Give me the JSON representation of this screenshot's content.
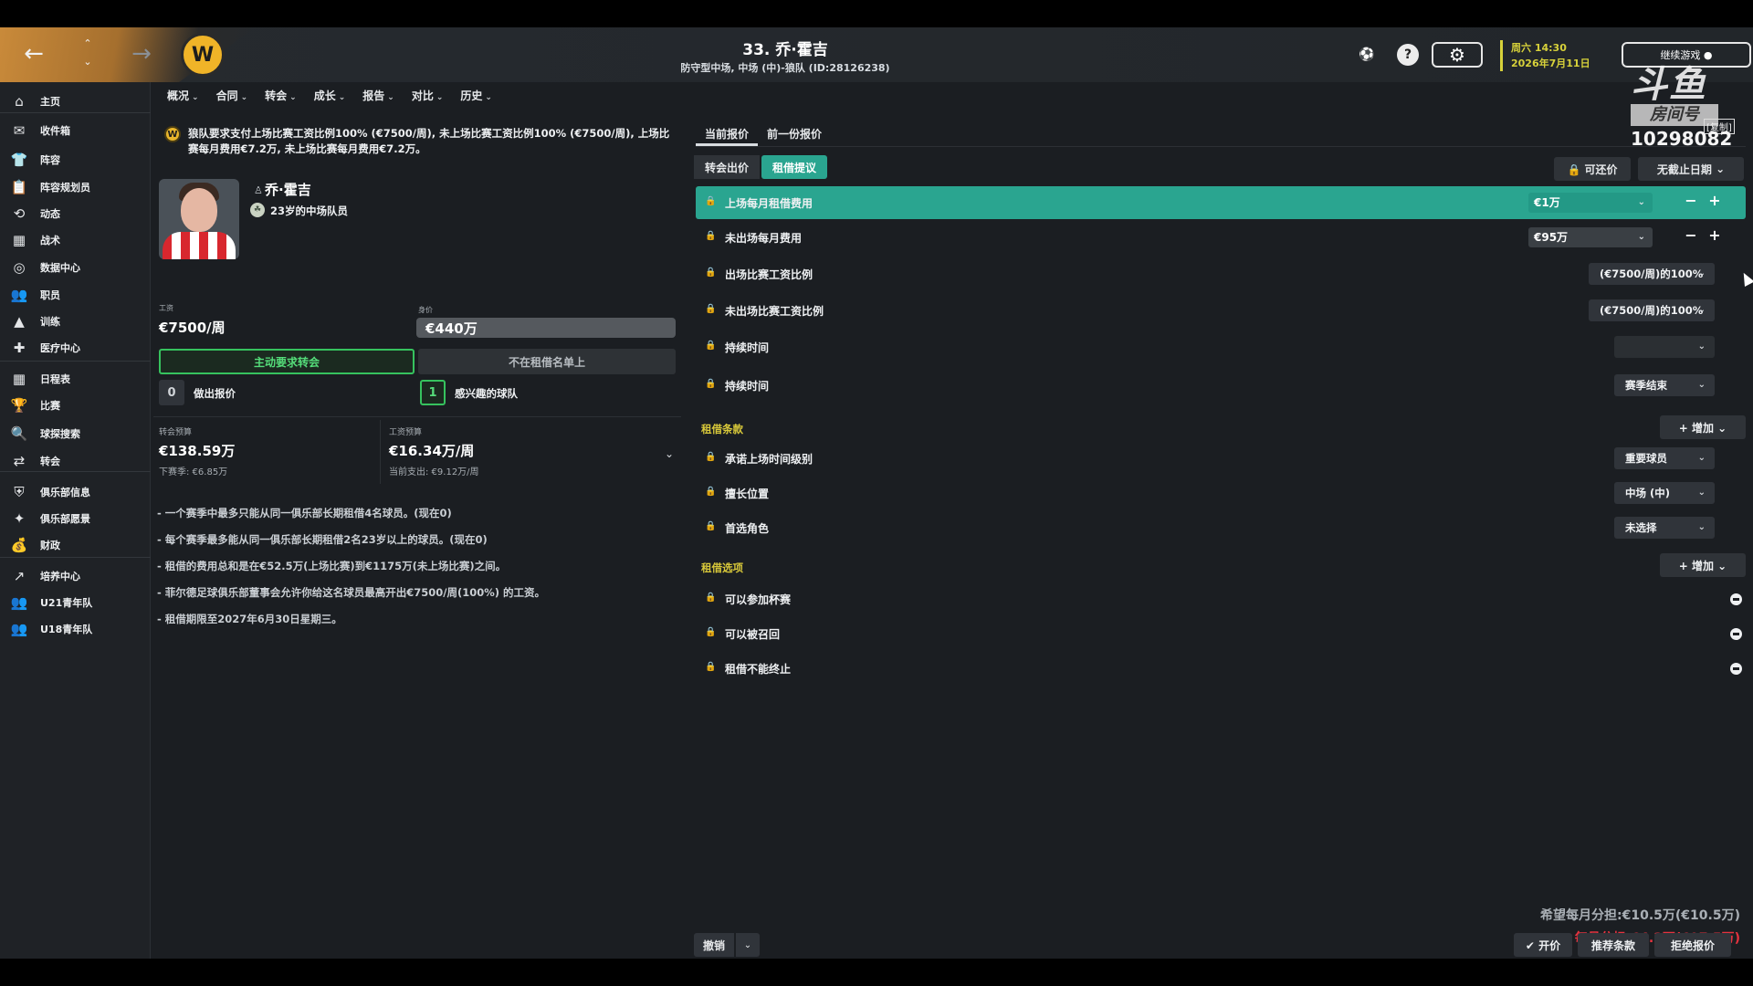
{
  "header": {
    "title": "33. 乔·霍吉",
    "subtitle": "防守型中场, 中场 (中)-狼队 (ID:28126238)",
    "back_icon": "←",
    "forward_icon": "→",
    "up_icon": "⌃",
    "down_icon": "⌄",
    "crest_icon": "W",
    "ball_icon": "⚽",
    "help_icon": "?",
    "settings_icon": "⚙",
    "date_line1": "周六 14:30",
    "date_line2": "2026年7月11日",
    "continue_label": "继续游戏 ●"
  },
  "watermark": {
    "logo": "斗鱼",
    "room_label": "房间号",
    "room_number": "10298082",
    "tag": "[复制]"
  },
  "sidebar": {
    "items": [
      {
        "label": "主页",
        "icon": "⌂"
      },
      {
        "label": "收件箱",
        "icon": "✉"
      },
      {
        "label": "阵容",
        "icon": "👕"
      },
      {
        "label": "阵容规划员",
        "icon": "📋"
      },
      {
        "label": "动态",
        "icon": "⟲"
      },
      {
        "label": "战术",
        "icon": "▦"
      },
      {
        "label": "数据中心",
        "icon": "◎"
      },
      {
        "label": "职员",
        "icon": "👥"
      },
      {
        "label": "训练",
        "icon": "▲"
      },
      {
        "label": "医疗中心",
        "icon": "✚"
      },
      {
        "label": "日程表",
        "icon": "▦"
      },
      {
        "label": "比赛",
        "icon": "🏆"
      },
      {
        "label": "球探搜索",
        "icon": "🔍"
      },
      {
        "label": "转会",
        "icon": "⇄"
      },
      {
        "label": "俱乐部信息",
        "icon": "⛨"
      },
      {
        "label": "俱乐部愿景",
        "icon": "✦"
      },
      {
        "label": "财政",
        "icon": "💰"
      },
      {
        "label": "培养中心",
        "icon": "↗"
      },
      {
        "label": "U21青年队",
        "icon": "👥"
      },
      {
        "label": "U18青年队",
        "icon": "👥"
      }
    ]
  },
  "menu": {
    "items": [
      "概况",
      "合同",
      "转会",
      "成长",
      "报告",
      "对比",
      "历史"
    ],
    "chevron": "⌄"
  },
  "left": {
    "notice_icon": "W",
    "notice": "狼队要求支付上场比赛工资比例100% (€7500/周), 未上场比赛工资比例100% (€7500/周), 上场比赛每月费用€7.2万, 未上场比赛每月费用€7.2万。",
    "player_name": "乔·霍吉",
    "player_name_icon": "♙",
    "player_desc": "23岁的中场队员",
    "player_desc_icon": "☘",
    "wage_label": "工资",
    "wage_value": "€7500/周",
    "value_label": "身价",
    "value_value": "€440万",
    "btn_transfer": "主动要求转会",
    "btn_not_loan": "不在租借名单上",
    "offers_count": "0",
    "offers_label": "做出报价",
    "interest_count": "1",
    "interest_label": "感兴趣的球队",
    "transfer_budget_label": "转会预算",
    "transfer_budget_value": "€138.59万",
    "transfer_budget_sub": "下赛季: €6.85万",
    "wage_budget_label": "工资预算",
    "wage_budget_value": "€16.34万/周",
    "wage_budget_sub": "当前支出: €9.12万/周",
    "rules": [
      "- 一个赛季中最多只能从同一俱乐部长期租借4名球员。(现在0)",
      "- 每个赛季最多能从同一俱乐部长期租借2名23岁以上的球员。(现在0)",
      "- 租借的费用总和是在€52.5万(上场比赛)到€1175万(未上场比赛)之间。",
      "- 菲尔德足球俱乐部董事会允许你给这名球员最高开出€7500/周(100%) 的工资。",
      "- 租借期限至2027年6月30日星期三。"
    ]
  },
  "right": {
    "tabs": [
      "当前报价",
      "前一份报价"
    ],
    "seg_transfer": "转会出价",
    "seg_loan": "租借提议",
    "negotiable": "🔒 可还价",
    "no_end": "无截止日期",
    "lock_icon": "🔒",
    "dd_icon": "⌄",
    "minus": "−",
    "plus": "+",
    "fee_played_label": "上场每月租借费用",
    "fee_played_value": "€1万",
    "fee_unplayed_label": "未出场每月费用",
    "fee_unplayed_value": "€95万",
    "wage_played_label": "出场比赛工资比例",
    "wage_played_value": "(€7500/周)的100%",
    "wage_unplayed_label": "未出场比赛工资比例",
    "wage_unplayed_value": "(€7500/周)的100%",
    "duration1_label": "持续时间",
    "duration2_label": "持续时间",
    "duration2_value": "赛季结束",
    "loan_terms_title": "租借条款",
    "add_label": "+ 增加 ⌄",
    "playtime_label": "承诺上场时间级别",
    "playtime_value": "重要球员",
    "position_label": "擅长位置",
    "position_value": "中场 (中)",
    "role_label": "首选角色",
    "role_value": "未选择",
    "loan_options_title": "租借选项",
    "cup_label": "可以参加杯赛",
    "recall_label": "可以被召回",
    "no_terminate_label": "租借不能终止",
    "hope_text": "希望每月分担:€10.5万(€10.5万)",
    "monthly_text": "每月分担:€4.3万(€97.5万)",
    "undo": "撤销",
    "propose": "✔ 开价",
    "suggest": "推荐条款",
    "reject": "拒绝报价"
  }
}
